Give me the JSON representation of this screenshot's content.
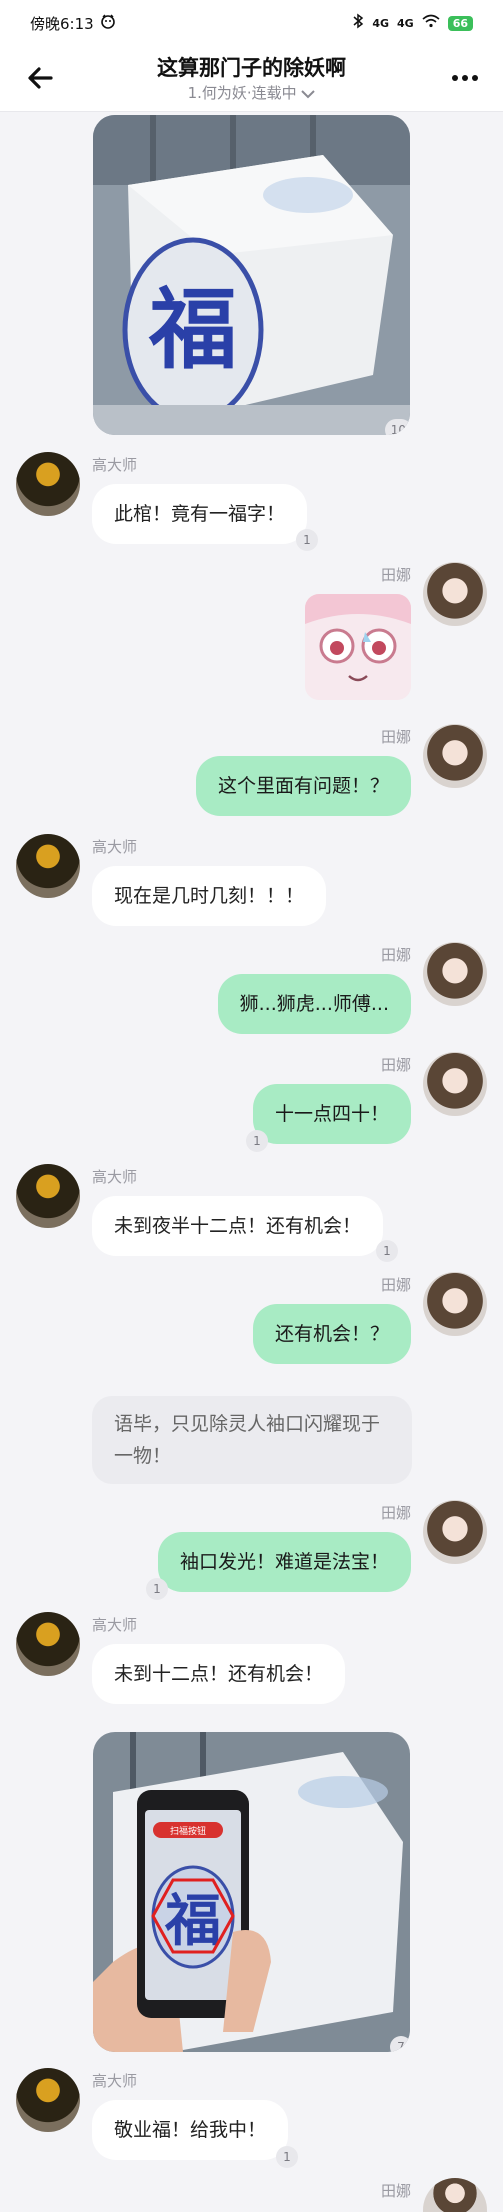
{
  "status": {
    "time": "傍晚6:13",
    "signal_left": "4G",
    "signal_right": "4G",
    "battery": "66"
  },
  "nav": {
    "title": "这算那门子的除妖啊",
    "subtitle": "1.何为妖·连载中"
  },
  "messages": {
    "img1_count": "10",
    "m1": {
      "sender": "高大师",
      "text": "此棺！竟有一福字！",
      "count": "1"
    },
    "m2": {
      "sender": "田娜"
    },
    "m3": {
      "sender": "田娜",
      "text": "这个里面有问题！？"
    },
    "m4": {
      "sender": "高大师",
      "text": "现在是几时几刻！！！"
    },
    "m5": {
      "sender": "田娜",
      "text": "狮...狮虎...师傅..."
    },
    "m6": {
      "sender": "田娜",
      "text": "十一点四十！",
      "count": "1"
    },
    "m7": {
      "sender": "高大师",
      "text": "未到夜半十二点！还有机会！",
      "count": "1"
    },
    "m8": {
      "sender": "田娜",
      "text": "还有机会！？"
    },
    "narration": "语毕，只见除灵人袖口闪耀现于一物！",
    "m9": {
      "sender": "田娜",
      "text": "袖口发光！难道是法宝！",
      "count": "1"
    },
    "m10": {
      "sender": "高大师",
      "text": "未到十二点！还有机会！"
    },
    "img2_count": "7",
    "img2_phone_label": "扫福按钮",
    "m11": {
      "sender": "高大师",
      "text": "敬业福！给我中！",
      "count": "1"
    },
    "m12": {
      "sender": "田娜"
    }
  },
  "fu_char": "福"
}
